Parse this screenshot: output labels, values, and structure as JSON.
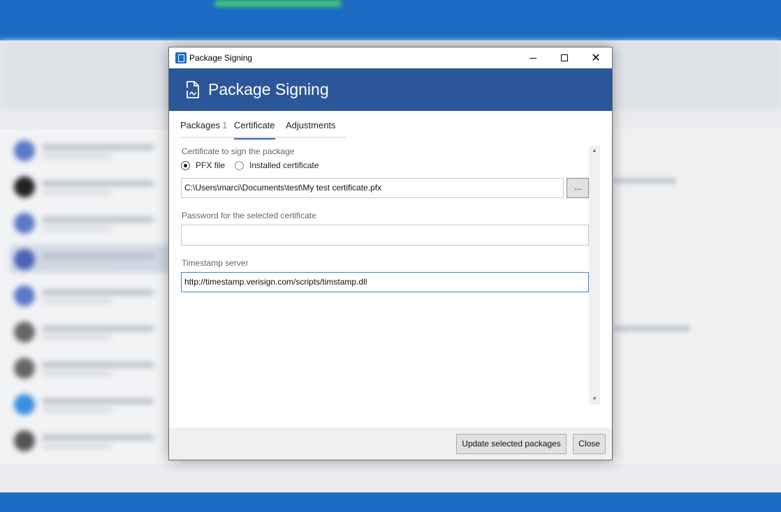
{
  "window": {
    "title": "Package Signing",
    "close_glyph": "✕"
  },
  "header": {
    "title": "Package Signing",
    "icon": "document-signature-icon"
  },
  "tabs": [
    {
      "label": "Packages",
      "count": "1"
    },
    {
      "label": "Certificate",
      "active": true
    },
    {
      "label": "Adjustments"
    }
  ],
  "certificate": {
    "section_label": "Certificate to sign the package",
    "options": [
      {
        "label": "PFX file",
        "checked": true
      },
      {
        "label": "Installed certificate",
        "checked": false
      }
    ],
    "pfx_path": "C:\\Users\\marci\\Documents\\test\\My test certificate.pfx",
    "browse_label": "..."
  },
  "password": {
    "label": "Password for the selected certificate",
    "value": ""
  },
  "timestamp": {
    "label": "Timestamp server",
    "value": "http://timestamp.verisign.com/scripts/timstamp.dll"
  },
  "scrollbar": {
    "up_glyph": "▲",
    "down_glyph": "▼"
  },
  "footer": {
    "update_label": "Update selected packages",
    "close_label": "Close"
  },
  "colors": {
    "header_bg": "#2b579a",
    "accent": "#1c6cc4",
    "focus_border": "#3a86d6"
  }
}
